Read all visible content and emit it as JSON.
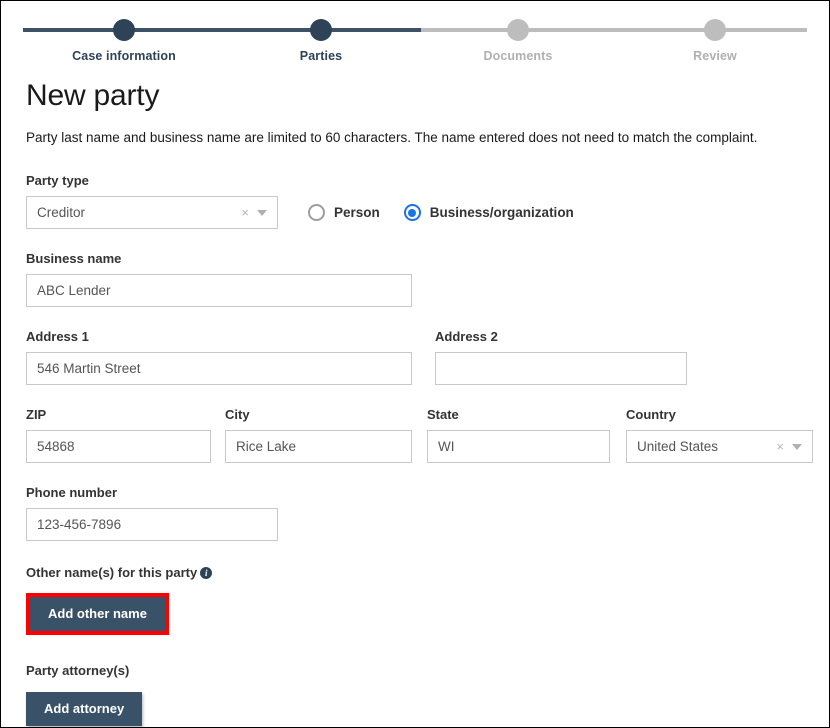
{
  "stepper": {
    "steps": [
      {
        "label": "Case information",
        "state": "done"
      },
      {
        "label": "Parties",
        "state": "done"
      },
      {
        "label": "Documents",
        "state": "todo"
      },
      {
        "label": "Review",
        "state": "todo"
      }
    ],
    "active_color": "#2e4357",
    "inactive_color": "#bdbdbd"
  },
  "main": {
    "title": "New party",
    "intro": "Party last name and business name are limited to 60 characters. The name entered does not need to match the complaint.",
    "party_type": {
      "label": "Party type",
      "value": "Creditor",
      "clear_icon": "×"
    },
    "entity_radio": {
      "options": [
        {
          "label": "Person",
          "selected": false
        },
        {
          "label": "Business/organization",
          "selected": true
        }
      ],
      "selected_color": "#1a73e8"
    },
    "business_name": {
      "label": "Business name",
      "value": "ABC Lender",
      "placeholder": ""
    },
    "address_1": {
      "label": "Address 1",
      "value": "546 Martin Street",
      "placeholder": ""
    },
    "address_2": {
      "label": "Address 2",
      "value": "",
      "placeholder": ""
    },
    "zip": {
      "label": "ZIP",
      "value": "54868",
      "placeholder": ""
    },
    "city": {
      "label": "City",
      "value": "Rice Lake",
      "placeholder": ""
    },
    "state": {
      "label": "State",
      "value": "WI",
      "placeholder": ""
    },
    "country": {
      "label": "Country",
      "value": "United States",
      "clear_icon": "×"
    },
    "phone": {
      "label": "Phone number",
      "value": "123-456-7896",
      "placeholder": ""
    },
    "other_names": {
      "label": "Other name(s) for this party",
      "info_glyph": "i",
      "add_button": "Add other name",
      "highlight_color": "#ff0000"
    },
    "attorneys": {
      "label": "Party attorney(s)",
      "add_button": "Add attorney"
    },
    "button_color": "#3a5268"
  }
}
